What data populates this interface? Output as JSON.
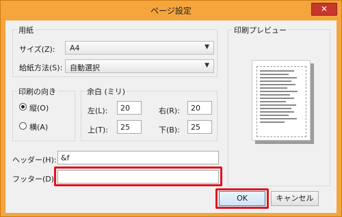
{
  "window": {
    "title": "ページ設定",
    "close_glyph": "✕"
  },
  "paper_group": {
    "title": "用紙",
    "size_label": "サイズ(Z):",
    "size_value": "A4",
    "source_label": "給紙方法(S):",
    "source_value": "自動選択"
  },
  "orientation_group": {
    "title": "印刷の向き",
    "portrait_label": "縦(O)",
    "landscape_label": "横(A)",
    "selected": "portrait"
  },
  "margins_group": {
    "title": "余白 (ミリ)",
    "left_label": "左(L):",
    "left_value": "20",
    "right_label": "右(R):",
    "right_value": "20",
    "top_label": "上(T):",
    "top_value": "25",
    "bottom_label": "下(B):",
    "bottom_value": "25"
  },
  "header_field": {
    "label": "ヘッダー(H):",
    "value": "&f"
  },
  "footer_field": {
    "label": "フッター(D):",
    "value": ""
  },
  "preview": {
    "title": "印刷プレビュー"
  },
  "buttons": {
    "ok": "OK",
    "cancel": "キャンセル"
  },
  "colors": {
    "highlight": "#e0141e",
    "titlebar": "#f4a53c",
    "close": "#c7372c"
  }
}
